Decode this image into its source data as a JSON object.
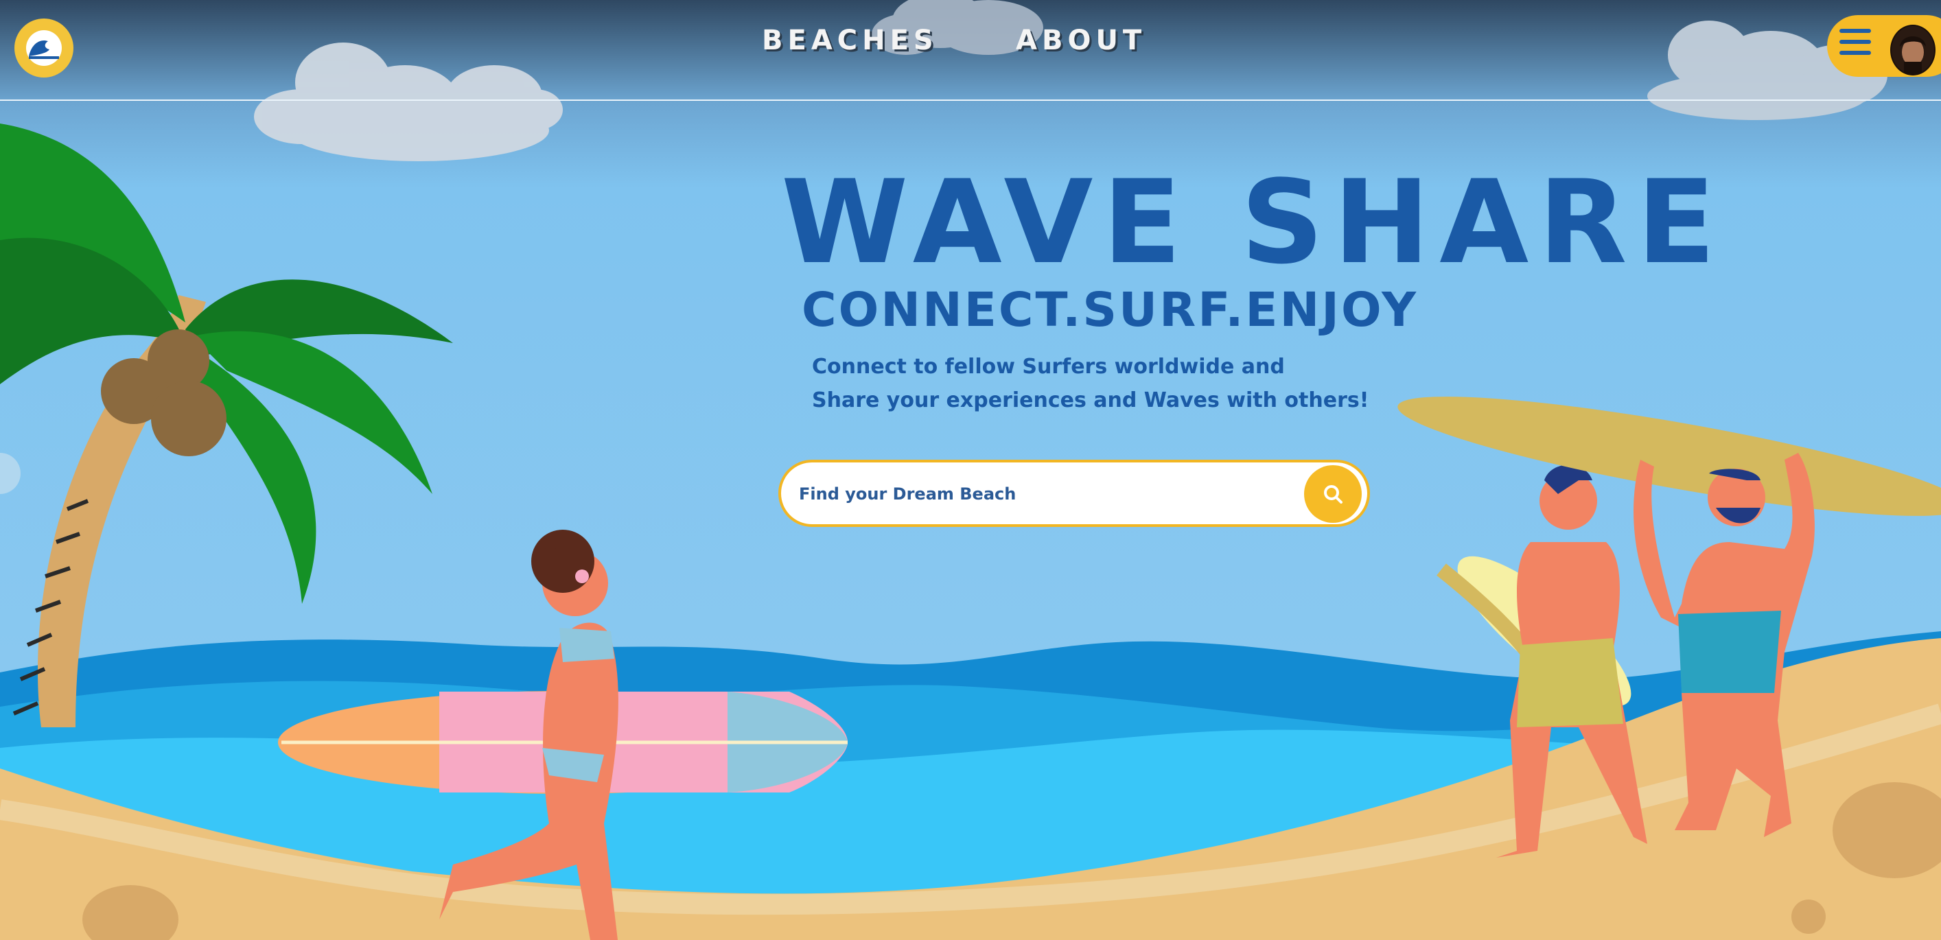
{
  "brand": {
    "logo_text_top": "WAVE SHARE",
    "logo_text_bottom": "CONNECT.SURF.ENJOY"
  },
  "nav": {
    "beaches": "BEACHES",
    "about": "ABOUT"
  },
  "menu": {
    "icon": "hamburger-icon",
    "avatar": "user-avatar"
  },
  "hero": {
    "title": "WAVE SHARE",
    "tagline": "CONNECT.SURF.ENJOY",
    "line1": "Connect to fellow Surfers worldwide and",
    "line2": "Share your experiences and Waves with others!"
  },
  "search": {
    "placeholder": "Find your Dream Beach",
    "button_icon": "search-icon"
  },
  "colors": {
    "sky": "#82c4ef",
    "title": "#1a5aa6",
    "accent": "#f6bb26",
    "sand": "#ecc27d",
    "sea": "#39c6f8"
  }
}
